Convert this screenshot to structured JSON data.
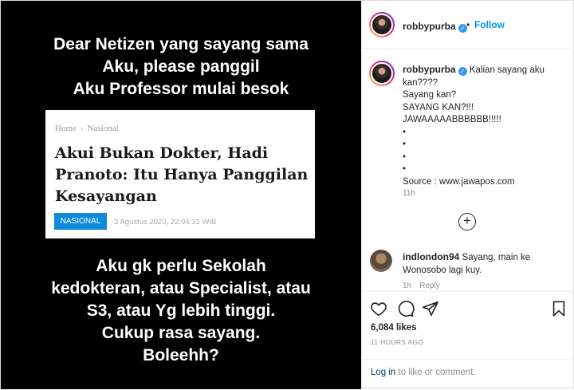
{
  "image": {
    "top_lines": [
      "Dear Netizen yang sayang sama",
      "Aku, please panggil",
      "Aku Professor mulai besok"
    ],
    "bottom_lines": [
      "Aku gk perlu Sekolah",
      "kedokteran, atau Specialist, atau",
      "S3, atau Yg lebih tinggi.",
      "Cukup rasa sayang.",
      "Boleehh?"
    ],
    "news": {
      "crumb_home": "Home",
      "crumb_sep": "›",
      "crumb_section": "Nasional",
      "headline": "Akui Bukan Dokter, Hadi Pranoto: Itu Hanya Panggilan Kesayangan",
      "badge": "NASIONAL",
      "date": "3 Agustus 2020, 22:04:31 WIB"
    }
  },
  "header": {
    "username": "robbypurba",
    "verified": "✓",
    "dot": "•",
    "follow": "Follow"
  },
  "caption": {
    "username": "robbypurba",
    "verified": "✓",
    "first": "Kalian sayang aku kan????",
    "lines": [
      "Sayang kan?",
      "SAYANG KAN?!!!",
      "JAWAAAAABBBBBB!!!!!",
      "•",
      "•",
      "•",
      "•",
      "Source : www.jawapos.com"
    ],
    "time": "11h"
  },
  "more_comments": "+",
  "comment2": {
    "username": "indlondon94",
    "text": "Sayang, main ke Wonosobo lagi kuy.",
    "time": "1h",
    "reply": "Reply"
  },
  "actions": {
    "likes": "6,084 likes",
    "ago": "11 HOURS AGO",
    "login_link": "Log in",
    "login_rest": " to like or comment."
  }
}
